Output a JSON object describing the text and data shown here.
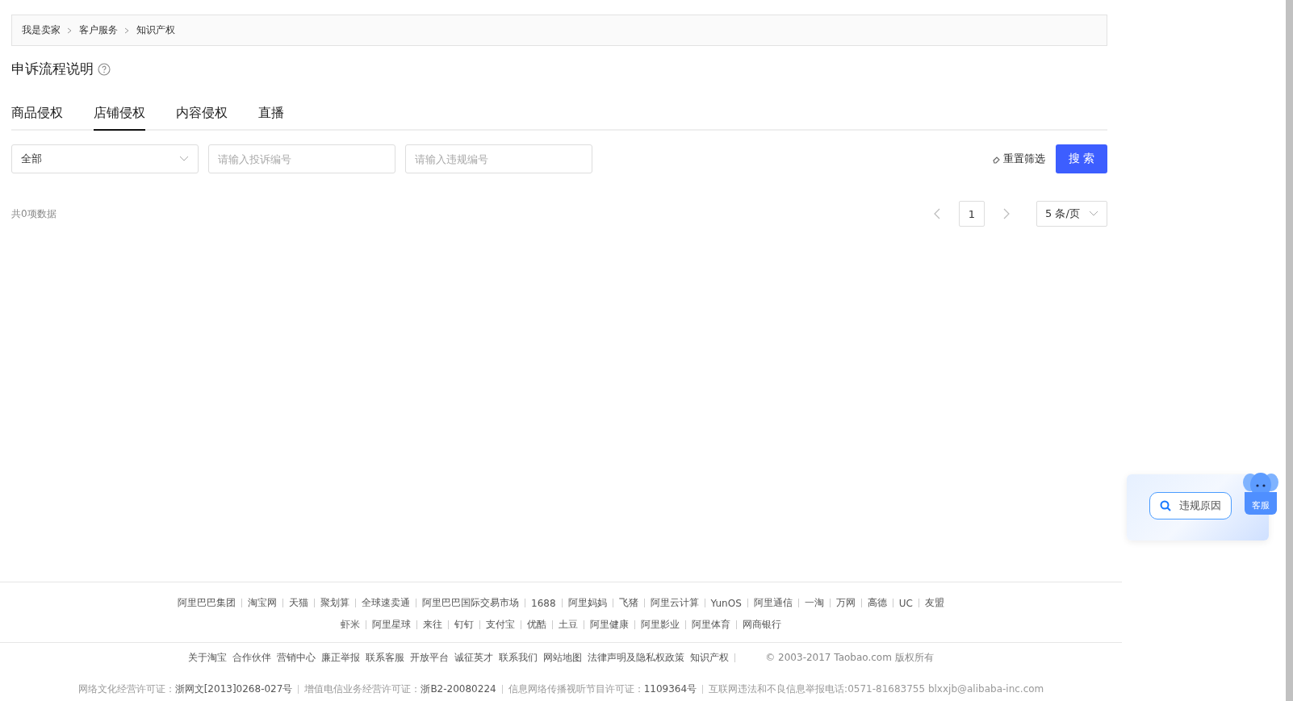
{
  "breadcrumb": [
    "我是卖家",
    "客户服务",
    "知识产权"
  ],
  "title": "申诉流程说明",
  "tabs": [
    {
      "label": "商品侵权",
      "selected": false
    },
    {
      "label": "店铺侵权",
      "selected": true
    },
    {
      "label": "内容侵权",
      "selected": false
    },
    {
      "label": "直播",
      "selected": false
    }
  ],
  "filters": {
    "type_select": "全部",
    "complaint_no": {
      "placeholder": "请输入投诉编号"
    },
    "violation_no": {
      "placeholder": "请输入违规编号"
    },
    "reset": "重置筛选",
    "search": "搜 索"
  },
  "total": "共0项数据",
  "pagination": {
    "page": "1",
    "page_size": "5 条/页"
  },
  "float_widget": {
    "search_chip": "违规原因",
    "service": "客服"
  },
  "footer": {
    "links_row_1": [
      "阿里巴巴集团",
      "淘宝网",
      "天猫",
      "聚划算",
      "全球速卖通",
      "阿里巴巴国际交易市场",
      "1688",
      "阿里妈妈",
      "飞猪",
      "阿里云计算",
      "YunOS",
      "阿里通信",
      "一淘",
      "万网",
      "高德",
      "UC",
      "友盟"
    ],
    "links_row_2": [
      "虾米",
      "阿里星球",
      "来往",
      "钉钉",
      "支付宝",
      "优酷",
      "土豆",
      "阿里健康",
      "阿里影业",
      "阿里体育",
      "网商银行"
    ],
    "about_links": [
      "关于淘宝",
      "合作伙伴",
      "营销中心",
      "廉正举报",
      "联系客服",
      "开放平台",
      "诚征英才",
      "联系我们",
      "网站地图",
      "法律声明及隐私权政策",
      "知识产权"
    ],
    "copyright": "© 2003-2017 Taobao.com 版权所有",
    "licenses": [
      {
        "label": "网络文化经营许可证：",
        "value": "浙网文[2013]0268-027号"
      },
      {
        "label": "增值电信业务经营许可证：",
        "value": "浙B2-20080224"
      },
      {
        "label": "信息网络传播视听节目许可证：",
        "value": "1109364号"
      },
      {
        "label": "互联网违法和不良信息举报电话:0571-81683755 blxxjb@alibaba-inc.com"
      }
    ]
  }
}
